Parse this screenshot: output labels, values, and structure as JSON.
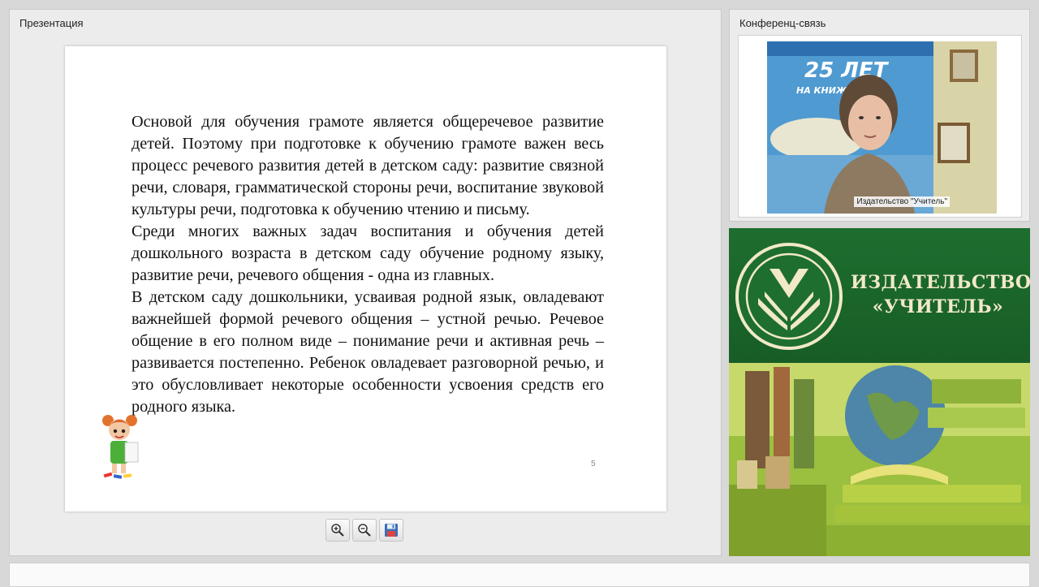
{
  "presentation": {
    "title": "Презентация",
    "slide": {
      "paragraphs": [
        "Основой для обучения грамоте является общеречевое развитие детей. Поэтому при подготовке к обучению грамоте важен весь процесс речевого развития детей в детском саду: развитие связной речи, словаря, грамматической стороны речи, воспитание звуковой культуры речи, подготовка к обучению чтению и письму.",
        "Среди многих важных задач воспитания и обучения детей дошкольного возраста в детском саду обучение родному языку, развитие речи, речевого общения - одна из главных.",
        "В детском саду дошкольники, усваивая родной язык, овладевают важнейшей формой речевого общения – устной речью. Речевое общение в его полном виде – понимание речи и активная речь – развивается постепенно. Ребенок овладевает разговорной речью, и это обусловливает некоторые особенности усвоения средств его родного языка."
      ],
      "page_number": "5"
    },
    "toolbar": {
      "zoom_in_icon": "zoom-in-icon",
      "zoom_out_icon": "zoom-out-icon",
      "save_icon": "floppy-disk-icon"
    }
  },
  "conference": {
    "title": "Конференц-связь",
    "video_label": "Издательство \"Учитель\"",
    "banner_text": [
      "25 ЛЕТ",
      "НА КНИЖНОМ Р"
    ]
  },
  "ad": {
    "title_line1": "ИЗДАТЕЛЬСТВО",
    "title_line2": "«УЧИТЕЛЬ»",
    "colors": {
      "green": "#1e6e2f",
      "cream": "#f1e9c8"
    }
  }
}
